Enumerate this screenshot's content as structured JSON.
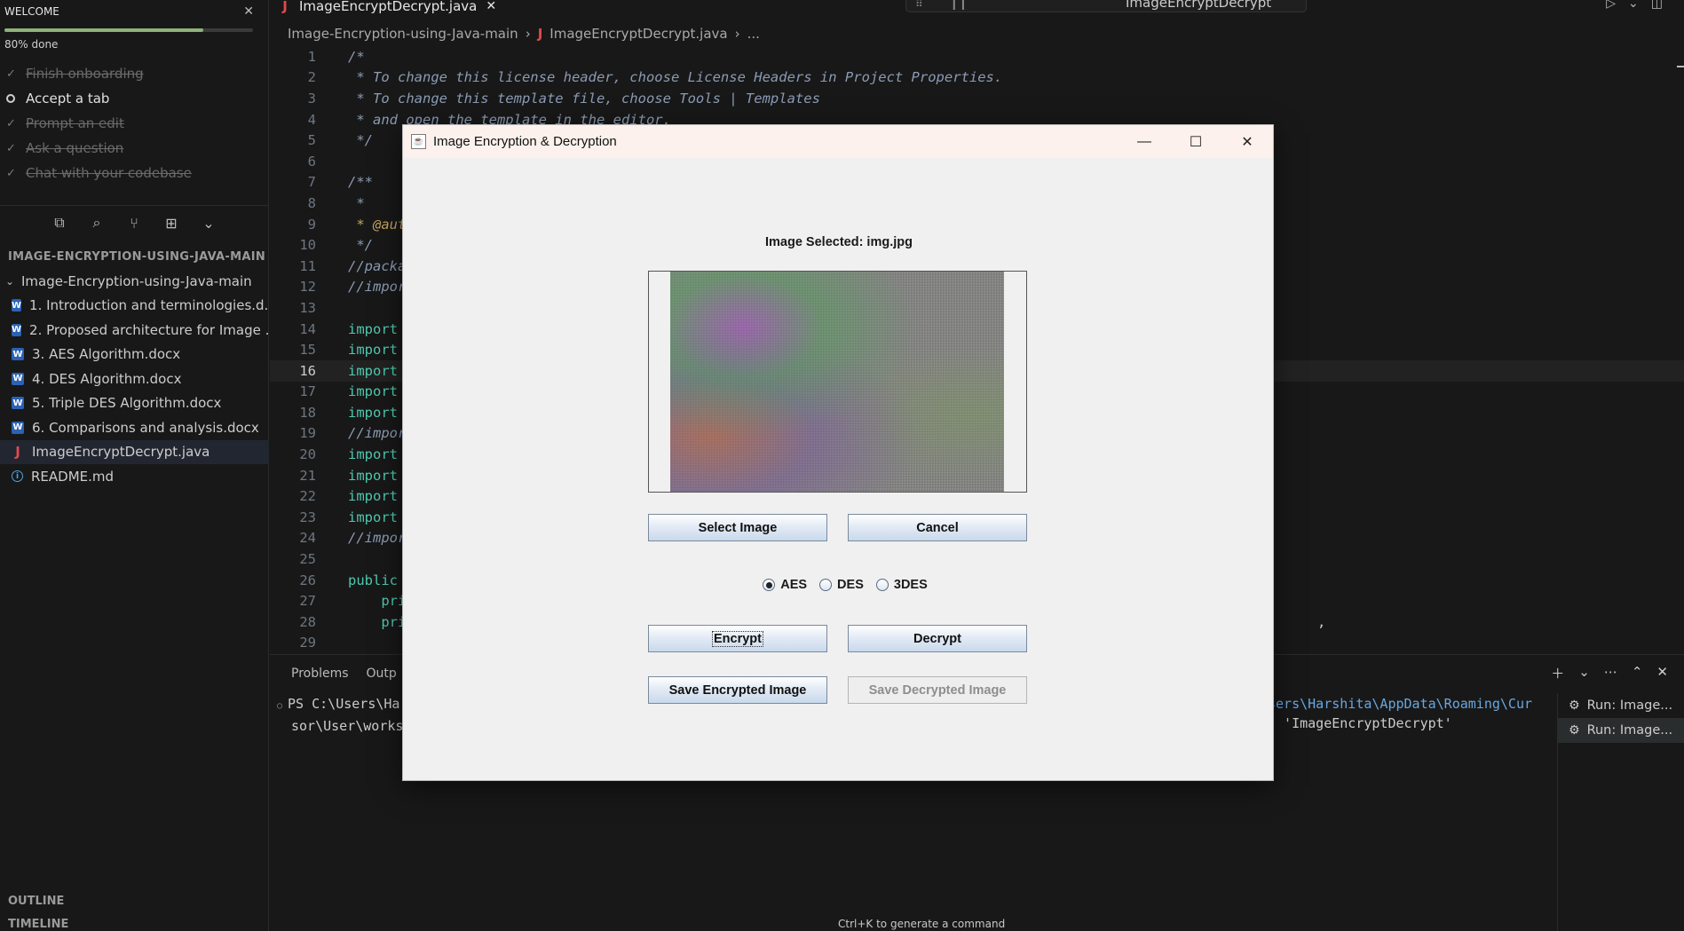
{
  "welcome": {
    "title": "WELCOME",
    "progress_label": "80% done",
    "progress_fraction": 0.8,
    "checklist": [
      {
        "label": "Finish onboarding",
        "done": true
      },
      {
        "label": "Accept a tab",
        "done": false
      },
      {
        "label": "Prompt an edit",
        "done": true
      },
      {
        "label": "Ask a question",
        "done": true
      },
      {
        "label": "Chat with your codebase",
        "done": true
      }
    ]
  },
  "explorer": {
    "section_title": "IMAGE-ENCRYPTION-USING-JAVA-MAIN",
    "folder": "Image-Encryption-using-Java-main",
    "files": [
      {
        "label": "1. Introduction and terminologies.d...",
        "icon": "word-icon"
      },
      {
        "label": "2. Proposed architecture for Image ...",
        "icon": "word-icon"
      },
      {
        "label": "3. AES Algorithm.docx",
        "icon": "word-icon"
      },
      {
        "label": "4. DES Algorithm.docx",
        "icon": "word-icon"
      },
      {
        "label": "5. Triple DES Algorithm.docx",
        "icon": "word-icon"
      },
      {
        "label": "6. Comparisons and analysis.docx",
        "icon": "word-icon"
      },
      {
        "label": "ImageEncryptDecrypt.java",
        "icon": "java-icon"
      },
      {
        "label": "README.md",
        "icon": "info-icon"
      }
    ],
    "outline": "OUTLINE",
    "timeline": "TIMELINE"
  },
  "editor": {
    "tab_label": "ImageEncryptDecrypt.java",
    "command_center": "ImageEncryptDecrypt",
    "breadcrumb": [
      "Image-Encryption-using-Java-main",
      "ImageEncryptDecrypt.java",
      "..."
    ],
    "current_line": 16,
    "lines": [
      {
        "n": "1",
        "t": "/*",
        "c": "cm"
      },
      {
        "n": "2",
        "t": " * To change this license header, choose License Headers in Project Properties.",
        "c": "cm"
      },
      {
        "n": "3",
        "t": " * To change this template file, choose Tools | Templates",
        "c": "cm"
      },
      {
        "n": "4",
        "t": " * and open the template in the editor.",
        "c": "cm"
      },
      {
        "n": "5",
        "t": " */",
        "c": "cm"
      },
      {
        "n": "6",
        "t": "",
        "c": ""
      },
      {
        "n": "7",
        "t": "/**",
        "c": "cm"
      },
      {
        "n": "8",
        "t": " *",
        "c": "cm"
      },
      {
        "n": "9",
        "t": " * @aut",
        "c": "an"
      },
      {
        "n": "10",
        "t": " */",
        "c": "cm"
      },
      {
        "n": "11",
        "t": "//packa",
        "c": "cm"
      },
      {
        "n": "12",
        "t": "//impor",
        "c": "cm"
      },
      {
        "n": "13",
        "t": "",
        "c": ""
      },
      {
        "n": "14",
        "t": "import",
        "c": "kw"
      },
      {
        "n": "15",
        "t": "import",
        "c": "kw"
      },
      {
        "n": "16",
        "t": "import",
        "c": "kw"
      },
      {
        "n": "17",
        "t": "import",
        "c": "kw"
      },
      {
        "n": "18",
        "t": "import",
        "c": "kw"
      },
      {
        "n": "19",
        "t": "//impor",
        "c": "cm"
      },
      {
        "n": "20",
        "t": "import",
        "c": "kw"
      },
      {
        "n": "21",
        "t": "import",
        "c": "kw"
      },
      {
        "n": "22",
        "t": "import",
        "c": "kw"
      },
      {
        "n": "23",
        "t": "import",
        "c": "kw"
      },
      {
        "n": "24",
        "t": "//impor",
        "c": "cm"
      },
      {
        "n": "25",
        "t": "",
        "c": ""
      },
      {
        "n": "26",
        "t": "public",
        "c": "kw"
      },
      {
        "n": "27",
        "t": "    pri",
        "c": "kw"
      },
      {
        "n": "28",
        "t": "    pri",
        "c": "kw"
      },
      {
        "n": "29",
        "t": "",
        "c": ""
      }
    ]
  },
  "panel": {
    "tabs": [
      "Problems",
      "Outp"
    ],
    "terminal_left": [
      "PS C:\\Users\\Ha",
      "sor\\User\\works"
    ],
    "terminal_right": [
      "sers\\Harshita\\AppData\\Roaming\\Cur",
      "' 'ImageEncryptDecrypt'"
    ],
    "line28_tail": ",",
    "runs": [
      "Run: Image...",
      "Run: Image..."
    ],
    "hint": "Ctrl+K to generate a command"
  },
  "dialog": {
    "title": "Image Encryption & Decryption",
    "selected_label": "Image Selected: img.jpg",
    "buttons": {
      "select_image": "Select Image",
      "cancel": "Cancel",
      "encrypt": "Encrypt",
      "decrypt": "Decrypt",
      "save_encrypted": "Save Encrypted Image",
      "save_decrypted": "Save Decrypted Image"
    },
    "algorithms": [
      {
        "label": "AES",
        "selected": true
      },
      {
        "label": "DES",
        "selected": false
      },
      {
        "label": "3DES",
        "selected": false
      }
    ]
  },
  "colors": {
    "progress": "#8fb27a",
    "keyword": "#4ec9b0",
    "comment": "#8b9bb4",
    "dialog_titlebar": "#fcf1ec",
    "java_icon": "#e04a4a"
  }
}
